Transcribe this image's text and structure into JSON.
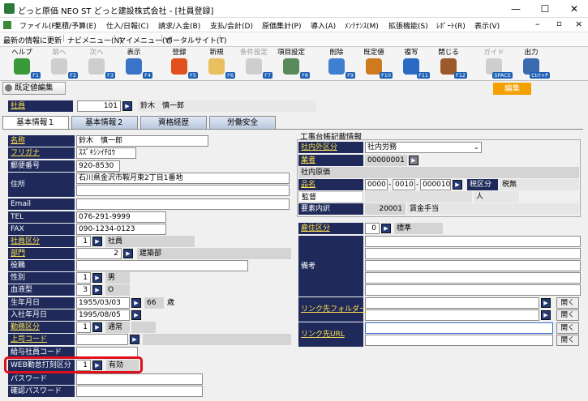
{
  "window": {
    "title": "どっと原価 NEO ST どっと建設株式会社 - [社員登録]",
    "min": "—",
    "max": "☐",
    "close": "✕"
  },
  "menu": [
    "ファイル(F)",
    "見積/予算(E)",
    "仕入/日報(C)",
    "請求/入金(B)",
    "支払/会計(D)",
    "原価集計(P)",
    "導入(A)",
    "ﾒﾝﾃﾅﾝｽ(M)",
    "拡張機能(S)",
    "ﾚﾎﾟｰﾄ(R)",
    "表示(V)"
  ],
  "nav": [
    "最新の情報に更新",
    "ナビメニュー(N)",
    "マイメニュー(Y)",
    "ポータルサイト(T)"
  ],
  "toolbar": [
    {
      "label": "ヘルプ",
      "key": "F1",
      "icon": "help-icon",
      "enabled": true,
      "color": "#3a9a3a"
    },
    {
      "label": "前へ",
      "key": "F2",
      "icon": "prev-icon",
      "enabled": false,
      "color": "#888"
    },
    {
      "label": "次へ",
      "key": "F3",
      "icon": "next-icon",
      "enabled": false,
      "color": "#888"
    },
    {
      "label": "表示",
      "key": "F4",
      "icon": "search-icon",
      "enabled": true,
      "color": "#3b73c6"
    },
    {
      "label": "登録",
      "key": "F5",
      "icon": "ok-icon",
      "enabled": true,
      "color": "#e2501e"
    },
    {
      "label": "新規",
      "key": "F6",
      "icon": "new-icon",
      "enabled": true,
      "color": "#e8c060"
    },
    {
      "label": "条件設定",
      "key": "F7",
      "icon": "condition-icon",
      "enabled": false,
      "color": "#888"
    },
    {
      "label": "項目設定",
      "key": "F8",
      "icon": "item-setting-icon",
      "enabled": true,
      "color": "#5a8a5a"
    },
    {
      "label": "削除",
      "key": "F9",
      "icon": "delete-icon",
      "enabled": true,
      "color": "#3f7fd0"
    },
    {
      "label": "既定値",
      "key": "F10",
      "icon": "default-icon",
      "enabled": true,
      "color": "#d07a20"
    },
    {
      "label": "複写",
      "key": "F11",
      "icon": "copy-icon",
      "enabled": true,
      "color": "#2a6ac4"
    },
    {
      "label": "閉じる",
      "key": "F12",
      "icon": "close-door-icon",
      "enabled": true,
      "color": "#9a5a2a"
    },
    {
      "label": "ガイド",
      "key": "SPACE",
      "icon": "guide-icon",
      "enabled": false,
      "color": "#888"
    },
    {
      "label": "出力",
      "key": "Ctrl+P",
      "icon": "print-icon",
      "enabled": true,
      "color": "#3a6ab0"
    }
  ],
  "default_edit": "既定値編集",
  "edit_badge": "編集",
  "employee": {
    "label": "社員",
    "code": "101",
    "name": "鈴木　慎一郎"
  },
  "tabs": [
    "基本情報１",
    "基本情報２",
    "資格経歴",
    "労働安全"
  ],
  "basic": {
    "name_label": "名称",
    "name": "鈴木　慎一郎",
    "kana_label": "フリガナ",
    "kana": "ｽｽﾞｷｼﾝｲﾁﾛｳ",
    "zip_label": "郵便番号",
    "zip": "920-8530",
    "address_label": "住所",
    "address": "石川県金沢市鞍月東2丁目1番地",
    "email_label": "Email",
    "tel_label": "TEL",
    "tel": "076-291-9999",
    "fax_label": "FAX",
    "fax": "090-1234-0123",
    "emp_class_label": "社員区分",
    "emp_class_code": "1",
    "emp_class": "社員",
    "dept_label": "部門",
    "dept_code": "2",
    "dept": "建築部",
    "post_label": "役職",
    "gender_label": "性別",
    "gender_code": "1",
    "gender": "男",
    "blood_label": "血液型",
    "blood_code": "3",
    "blood": "O",
    "birth_label": "生年月日",
    "birth": "1955/03/03",
    "age": "66",
    "age_unit": "歳",
    "join_label": "入社年月日",
    "join": "1995/08/05",
    "work_label": "勤務区分",
    "work_code": "1",
    "work": "通常",
    "boss_label": "上司コード",
    "payroll_label": "給与社員コード",
    "web_label": "WEB勤怠打刻区分",
    "web_code": "1",
    "web": "有効",
    "pw_label": "パスワード",
    "pw2_label": "確認パスワード"
  },
  "ledger": {
    "title": "工事台帳記載情報",
    "inout_label": "社内外区分",
    "inout": "社内労務",
    "vendor_label": "業者",
    "vendor_code": "00000001",
    "inhouse": "社内原価",
    "item_label": "品名",
    "item_code1": "0000",
    "item_code2": "0010",
    "item_code3": "000010",
    "tax_label": "税区分",
    "tax": "税無",
    "director_label": "監督",
    "unit": "人",
    "elem_label": "要素内訳",
    "elem_code": "20001",
    "elem": "賃金手当"
  },
  "extra": {
    "resident_label": "雇住区分",
    "resident_code": "0",
    "resident": "標準",
    "remarks_label": "備考",
    "link_folder_label": "リンク先フォルダー",
    "link_url_label": "リンク先URL",
    "open": "開く"
  }
}
